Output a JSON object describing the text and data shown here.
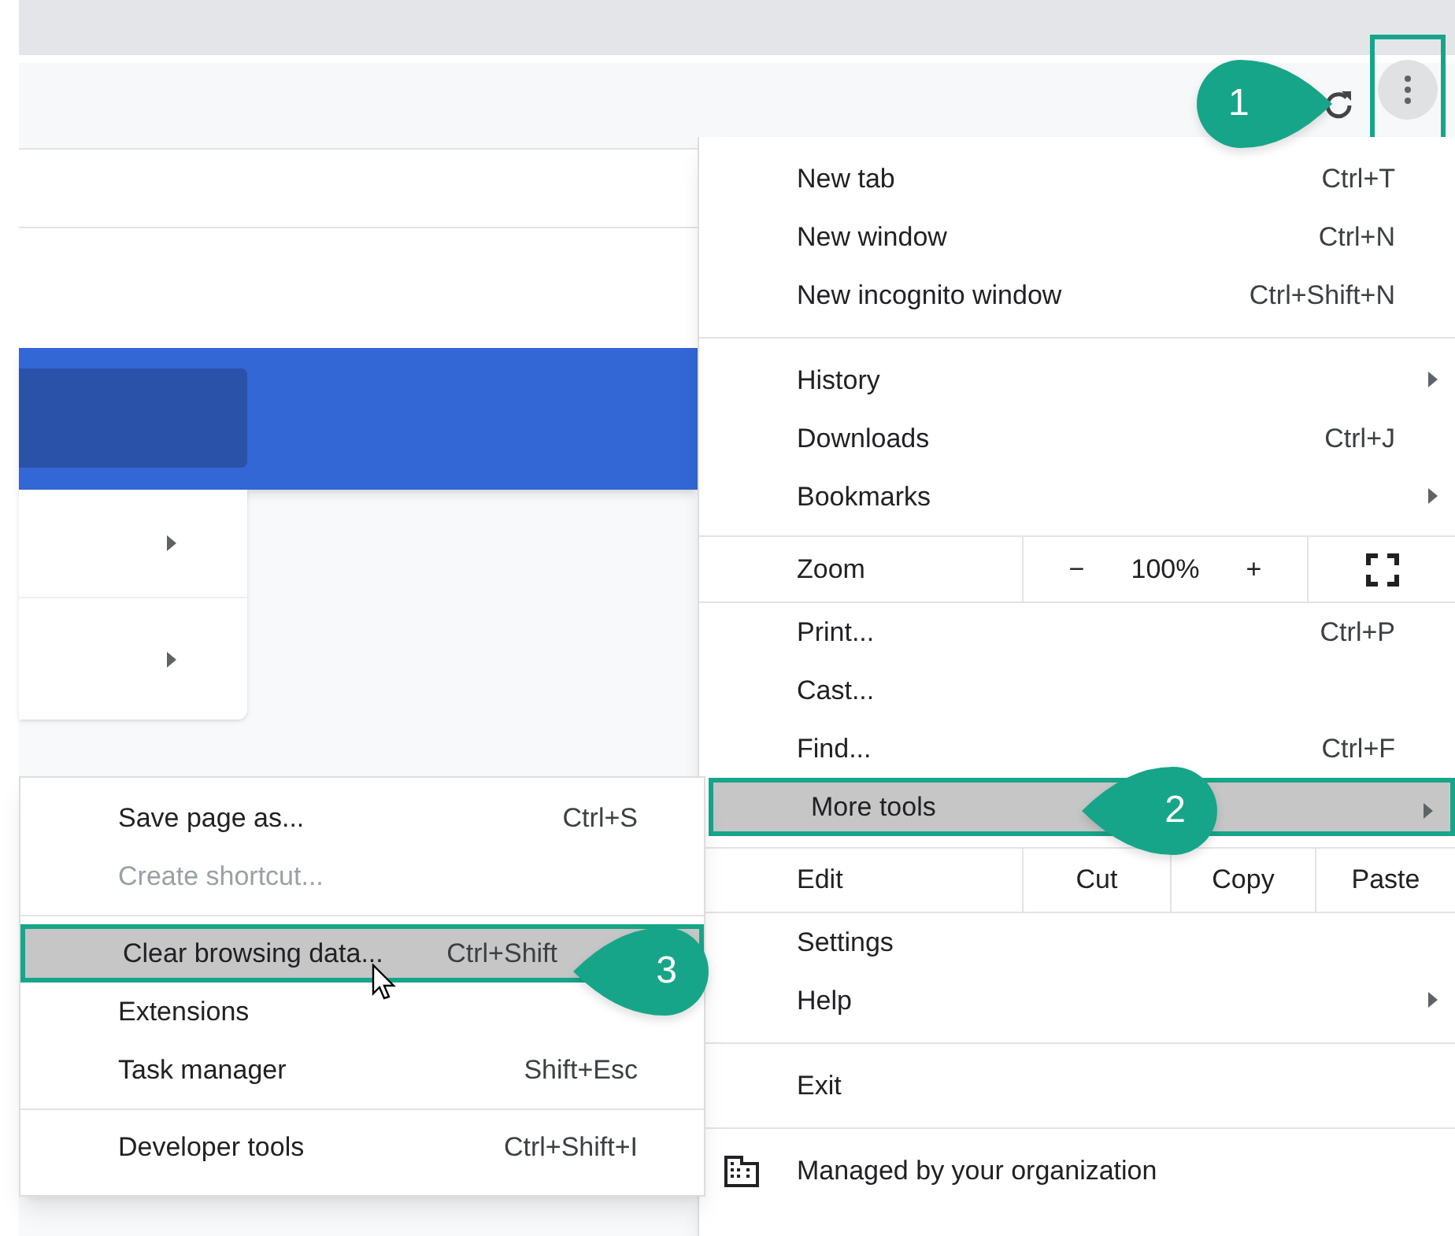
{
  "menu": {
    "items": [
      {
        "kind": "item",
        "label": "New tab",
        "shortcut": "Ctrl+T",
        "submenu": false,
        "highlighted": false
      },
      {
        "kind": "item",
        "label": "New window",
        "shortcut": "Ctrl+N",
        "submenu": false,
        "highlighted": false
      },
      {
        "kind": "item",
        "label": "New incognito window",
        "shortcut": "Ctrl+Shift+N",
        "submenu": false,
        "highlighted": false
      },
      {
        "kind": "divider"
      },
      {
        "kind": "item",
        "label": "History",
        "submenu": true,
        "highlighted": false
      },
      {
        "kind": "item",
        "label": "Downloads",
        "shortcut": "Ctrl+J",
        "submenu": false,
        "highlighted": false
      },
      {
        "kind": "item",
        "label": "Bookmarks",
        "submenu": true,
        "highlighted": false
      },
      {
        "kind": "zoom",
        "label": "Zoom",
        "minus": "−",
        "value": "100%",
        "plus": "+"
      },
      {
        "kind": "item",
        "label": "Print...",
        "shortcut": "Ctrl+P",
        "submenu": false,
        "highlighted": false
      },
      {
        "kind": "item",
        "label": "Cast...",
        "submenu": false,
        "highlighted": false
      },
      {
        "kind": "item",
        "label": "Find...",
        "shortcut": "Ctrl+F",
        "submenu": false,
        "highlighted": false
      },
      {
        "kind": "item",
        "label": "More tools",
        "submenu": true,
        "highlighted": true
      },
      {
        "kind": "edit",
        "label": "Edit",
        "actions": [
          "Cut",
          "Copy",
          "Paste"
        ]
      },
      {
        "kind": "item",
        "label": "Settings",
        "submenu": false,
        "highlighted": false
      },
      {
        "kind": "item",
        "label": "Help",
        "submenu": true,
        "highlighted": false
      },
      {
        "kind": "divider"
      },
      {
        "kind": "item",
        "label": "Exit",
        "submenu": false,
        "highlighted": false
      },
      {
        "kind": "managed",
        "label": "Managed by your organization"
      }
    ]
  },
  "submenu": {
    "items": [
      {
        "kind": "item",
        "label": "Save page as...",
        "shortcut": "Ctrl+S",
        "disabled": false,
        "highlighted": false
      },
      {
        "kind": "item",
        "label": "Create shortcut...",
        "disabled": true,
        "highlighted": false
      },
      {
        "kind": "divider"
      },
      {
        "kind": "item",
        "label": "Clear browsing data...",
        "shortcut": "Ctrl+Shift",
        "disabled": false,
        "highlighted": true
      },
      {
        "kind": "item",
        "label": "Extensions",
        "disabled": false,
        "highlighted": false
      },
      {
        "kind": "item",
        "label": "Task manager",
        "shortcut": "Shift+Esc",
        "disabled": false,
        "highlighted": false
      },
      {
        "kind": "divider"
      },
      {
        "kind": "item",
        "label": "Developer tools",
        "shortcut": "Ctrl+Shift+I",
        "disabled": false,
        "highlighted": false
      }
    ]
  },
  "callouts": [
    "1",
    "2",
    "3"
  ]
}
